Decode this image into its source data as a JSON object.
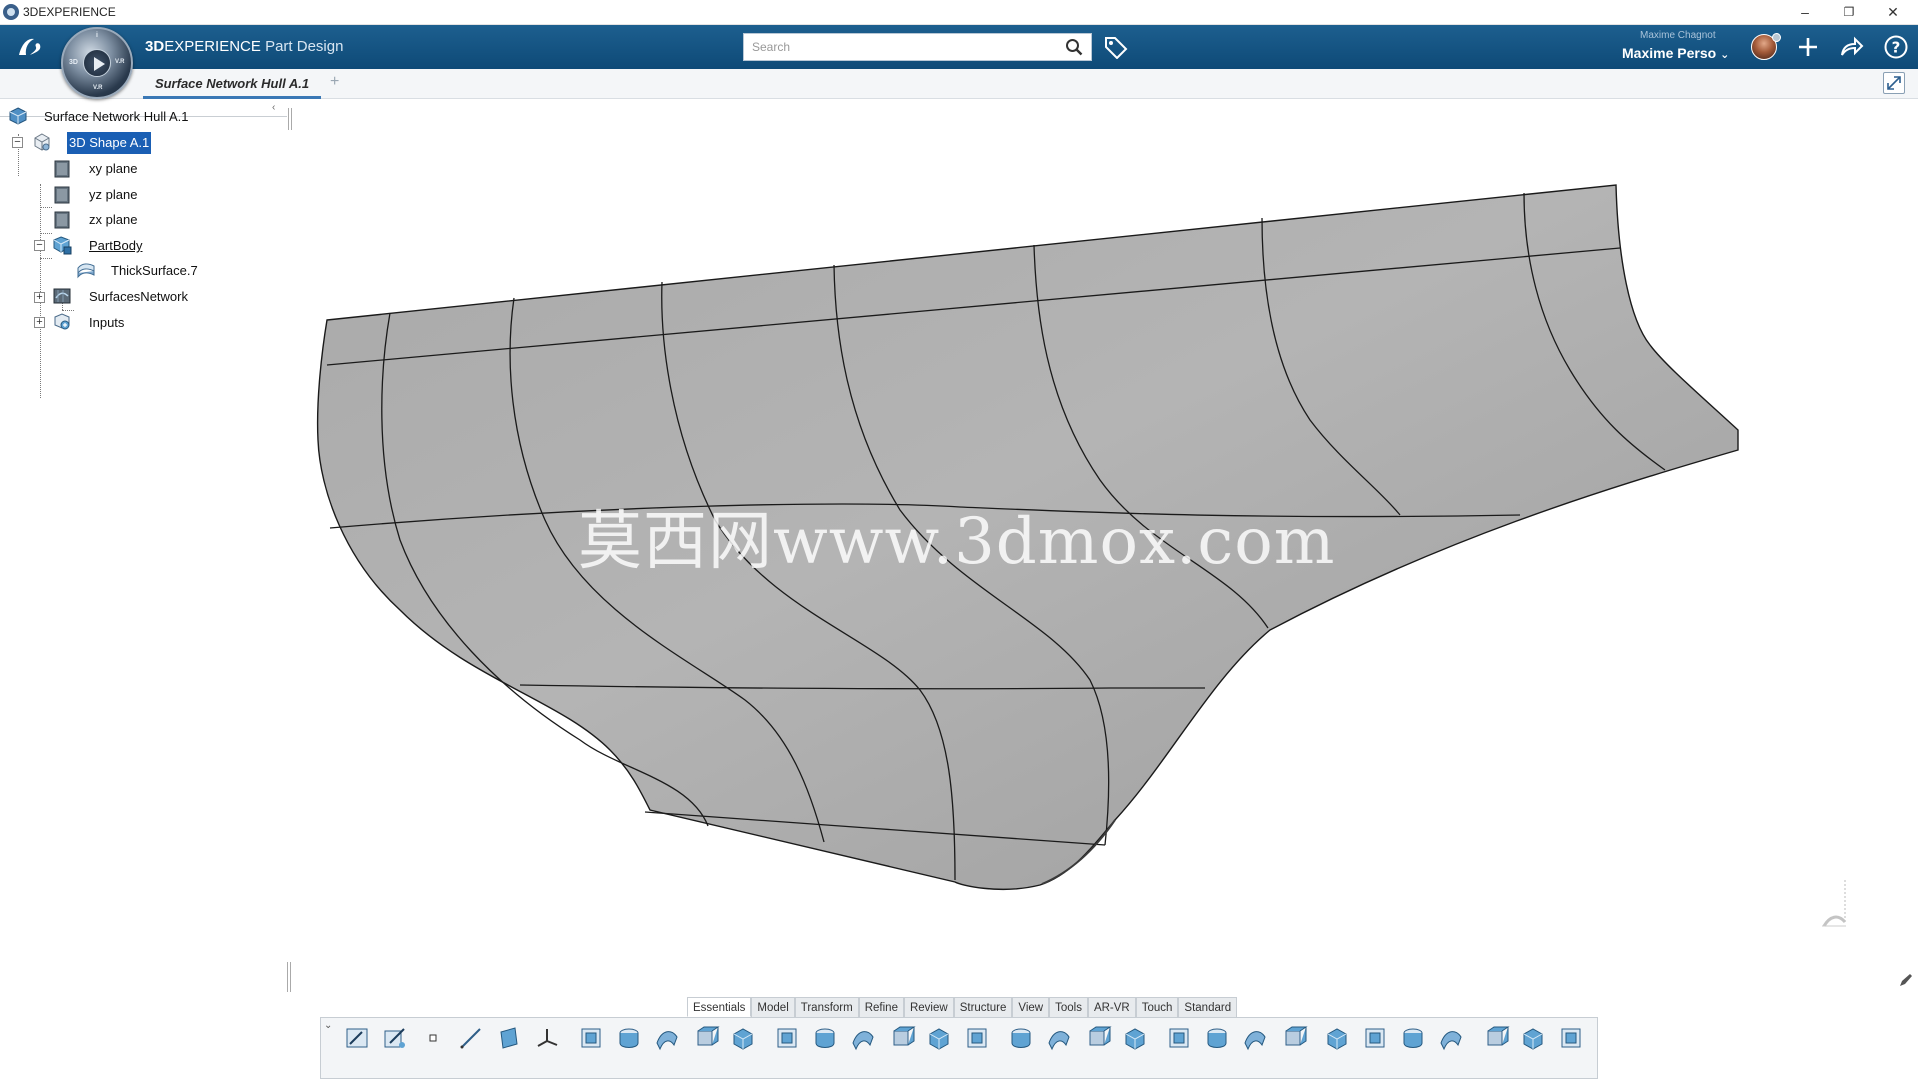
{
  "window": {
    "title": "3DEXPERIENCE",
    "controls": {
      "minimize": "–",
      "restore": "❐",
      "close": "✕"
    }
  },
  "app_bar": {
    "logo": "DS",
    "brand_prefix": "3D",
    "brand_suffix": "EXPERIENCE",
    "app_name": "Part Design",
    "compass_labels": {
      "top": "i",
      "left": "3D",
      "right": "V.R",
      "bottom": "V.R"
    },
    "search": {
      "placeholder": "Search",
      "value": ""
    },
    "user_small": "Maxime Chagnot",
    "user_main": "Maxime Perso",
    "icons": [
      "tag-icon",
      "plus-icon",
      "share-icon",
      "help-icon"
    ]
  },
  "tabs": {
    "document": "Surface Network Hull A.1",
    "add": "+"
  },
  "tree": {
    "collapse": "‹",
    "items": [
      {
        "label": "Surface Network Hull A.1",
        "icon": "product-icon"
      },
      {
        "label": "3D Shape A.1",
        "icon": "shape-icon",
        "selected": true,
        "expander": "−"
      },
      {
        "label": "xy plane",
        "icon": "plane-icon"
      },
      {
        "label": "yz plane",
        "icon": "plane-icon"
      },
      {
        "label": "zx plane",
        "icon": "plane-icon"
      },
      {
        "label": "PartBody",
        "icon": "body-icon",
        "expander": "−",
        "underlined": true
      },
      {
        "label": "ThickSurface.7",
        "icon": "thick-surface-icon"
      },
      {
        "label": "SurfacesNetwork",
        "icon": "surfaces-network-icon",
        "expander": "+"
      },
      {
        "label": "Inputs",
        "icon": "inputs-icon",
        "expander": "+"
      }
    ]
  },
  "viewport": {
    "watermark": "莫西网www.3dmox.com",
    "surface_color": "#aeaeae",
    "edge_color": "#1e1e1e"
  },
  "action_bar": {
    "tabs": [
      "Essentials",
      "Model",
      "Transform",
      "Refine",
      "Review",
      "Structure",
      "View",
      "Tools",
      "AR-VR",
      "Touch",
      "Standard"
    ],
    "active_tab": "Essentials",
    "toggle": "⌄",
    "tools": [
      "sketch-icon",
      "positioned-sketch-icon",
      "point-icon",
      "line-icon",
      "plane-icon",
      "axis-system-icon",
      "pad-icon",
      "pocket-icon",
      "shaft-icon",
      "hole-icon",
      "rib-icon",
      "shell-icon",
      "thickness-icon",
      "draft-icon",
      "multi-section-icon",
      "solid-combine-icon",
      "stiffener-icon",
      "rectangular-pattern-icon",
      "circular-pattern-icon",
      "user-pattern-icon",
      "mirror-icon",
      "box-icon",
      "chamfer-icon",
      "edge-fillet-icon",
      "face-fillet-icon",
      "assemble-icon",
      "add-icon",
      "remove-icon",
      "intersect-icon",
      "solid-icon",
      "surface-icon",
      "measure-icon"
    ]
  }
}
